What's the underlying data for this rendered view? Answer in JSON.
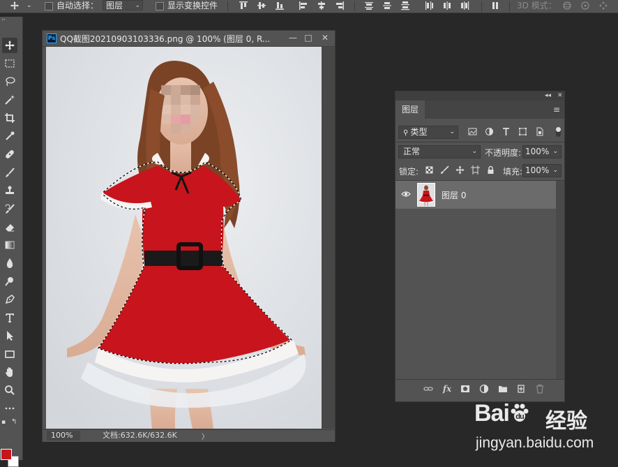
{
  "options_bar": {
    "auto_select_label": "自动选择：",
    "auto_select_value": "图层",
    "show_transform_label": "显示变换控件",
    "mode_3d_label": "3D 模式："
  },
  "document": {
    "title": "QQ截图20210903103336.png @ 100% (图层 0, R...",
    "ps_logo": "Ps",
    "zoom": "100%",
    "doc_info": "文档:632.6K/632.6K",
    "status_arrow": "〉",
    "min_glyph": "—",
    "max_glyph": "□",
    "close_glyph": "✕"
  },
  "layers_panel": {
    "collapse_glyph": "◂◂",
    "close_glyph": "✕",
    "tab": "图层",
    "filter_label": "类型",
    "blend_mode": "正常",
    "opacity_label": "不透明度:",
    "opacity_value": "100%",
    "lock_label": "锁定:",
    "fill_label": "填充:",
    "fill_value": "100%",
    "layers": [
      {
        "name": "图层 0",
        "visible": true
      }
    ],
    "fx_label": "fx"
  },
  "tools": [
    "move-tool",
    "marquee-tool",
    "lasso-tool",
    "magic-wand-tool",
    "crop-tool",
    "eyedropper-tool",
    "healing-brush-tool",
    "brush-tool",
    "clone-stamp-tool",
    "history-brush-tool",
    "eraser-tool",
    "gradient-tool",
    "blur-tool",
    "dodge-tool",
    "pen-tool",
    "type-tool",
    "path-selection-tool",
    "rectangle-tool",
    "hand-tool",
    "zoom-tool",
    "more-tools"
  ],
  "colors": {
    "foreground": "#c9141b",
    "background": "#ffffff",
    "panel": "#535353",
    "workspace": "#282828",
    "selected_layer": "#6b6b6b"
  },
  "watermark": {
    "brand": "Bai",
    "brand2": "du",
    "cn": "经验",
    "url": "jingyan.baidu.com"
  }
}
